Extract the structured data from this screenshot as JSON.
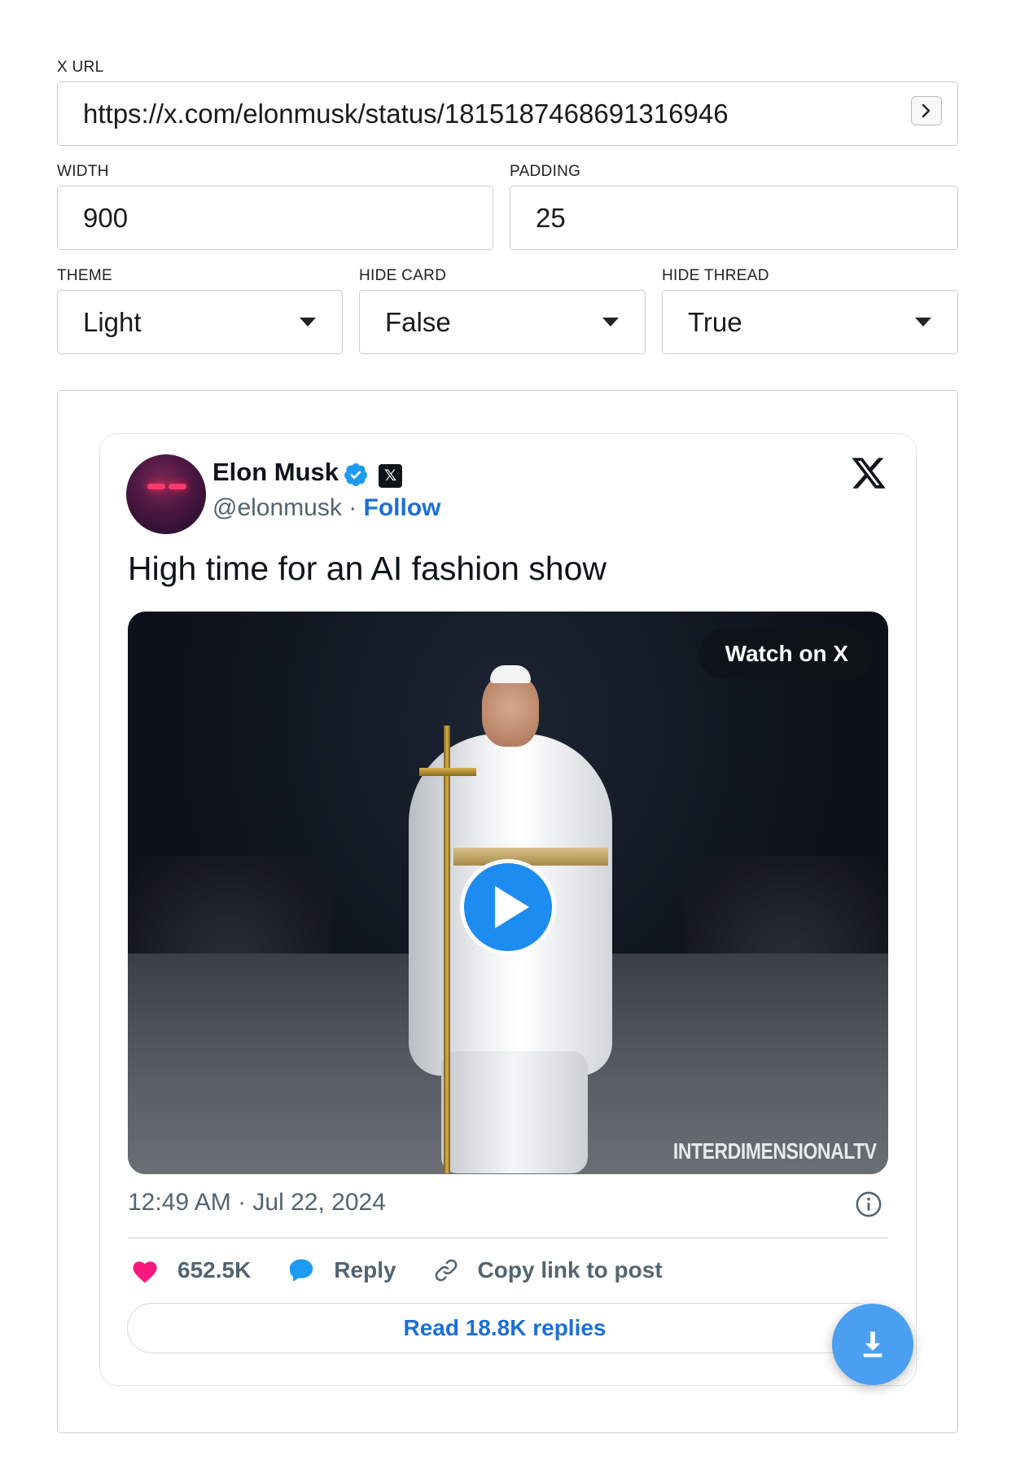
{
  "form": {
    "url": {
      "label": "X URL",
      "value": "https://x.com/elonmusk/status/1815187468691316946",
      "go_icon": "chevron-right-icon"
    },
    "width": {
      "label": "WIDTH",
      "value": "900"
    },
    "padding": {
      "label": "PADDING",
      "value": "25"
    },
    "theme": {
      "label": "THEME",
      "value": "Light"
    },
    "hide_card": {
      "label": "HIDE CARD",
      "value": "False"
    },
    "hide_thread": {
      "label": "HIDE THREAD",
      "value": "True"
    }
  },
  "tweet": {
    "author_name": "Elon Musk",
    "handle": "@elonmusk",
    "separator": " · ",
    "follow_label": "Follow",
    "text": "High time for an AI fashion show",
    "media": {
      "watch_label": "Watch on X",
      "watermark": "INTERDIMENSIONALTV"
    },
    "timestamp": "12:49 AM · Jul 22, 2024",
    "likes": "652.5K",
    "reply_label": "Reply",
    "copy_link_label": "Copy link to post",
    "read_replies_label": "Read 18.8K replies"
  },
  "colors": {
    "accent": "#1d6fd6",
    "like": "#f91880",
    "fab": "#4a9ff0"
  }
}
